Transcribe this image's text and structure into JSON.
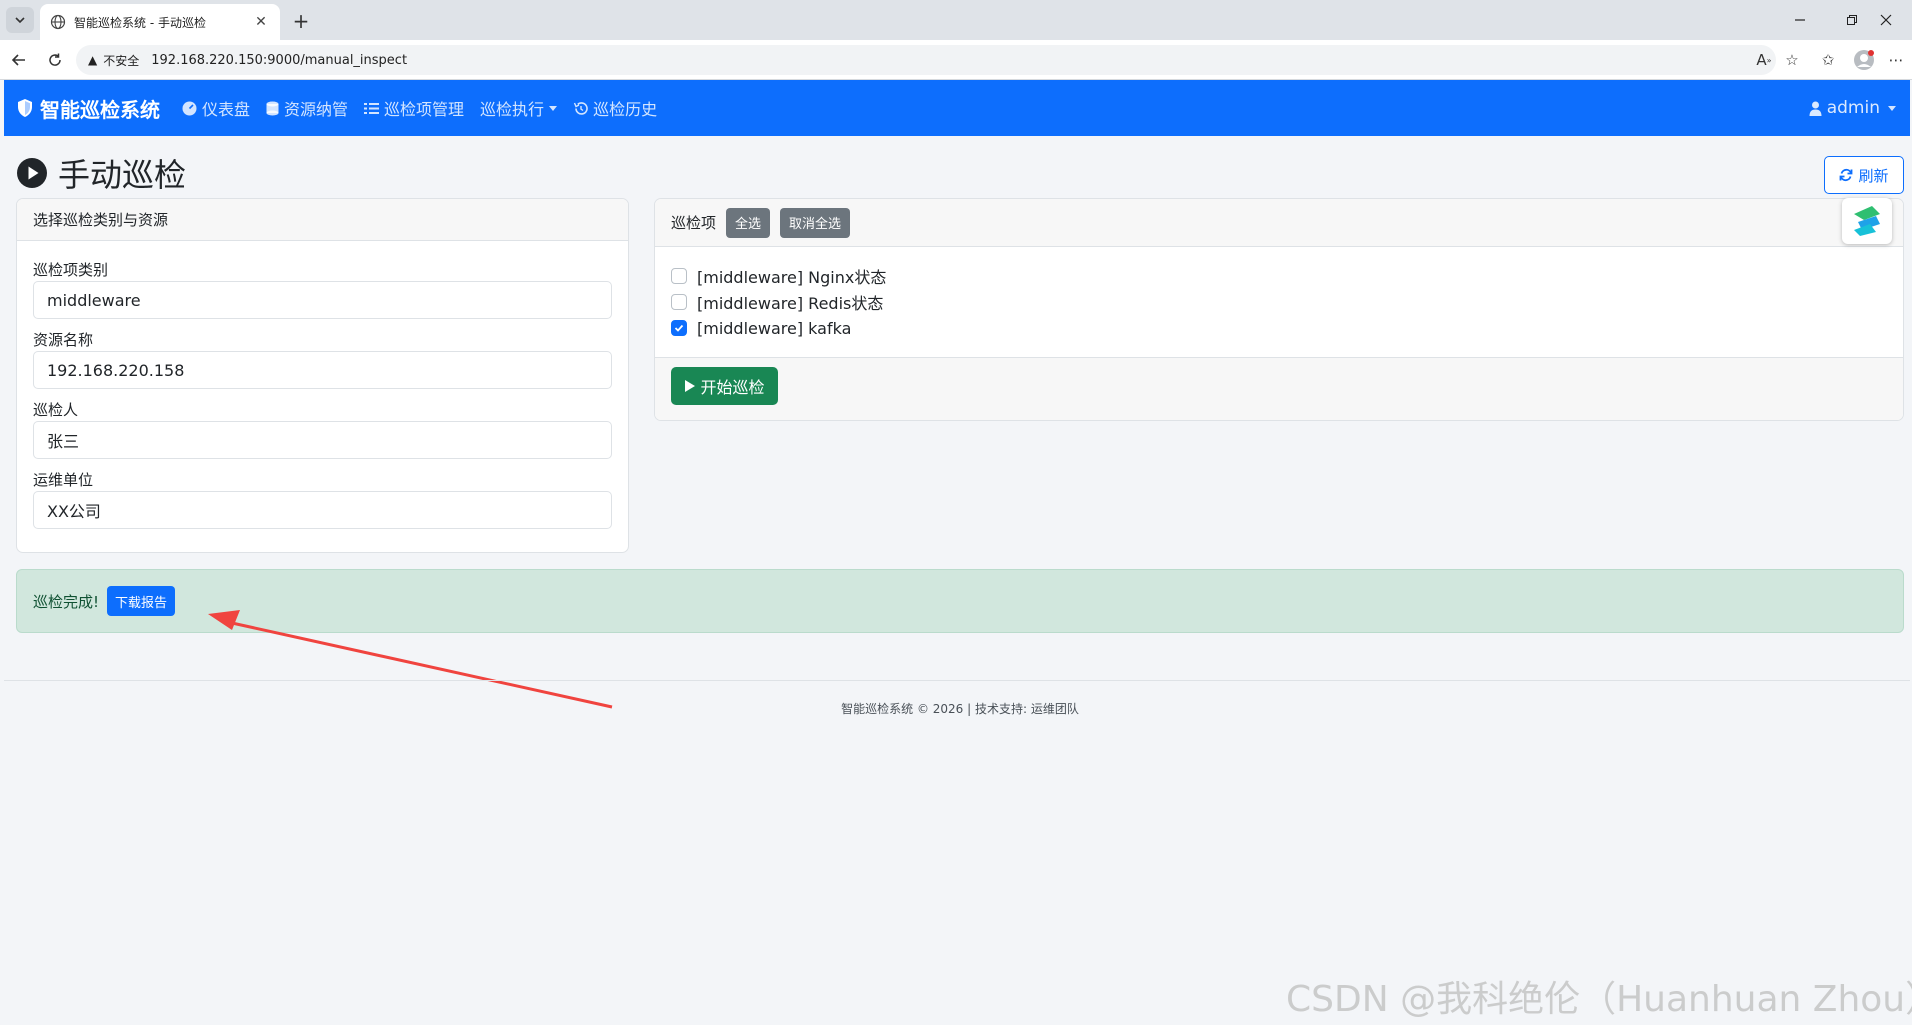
{
  "browser": {
    "tab_title": "智能巡检系统 - 手动巡检",
    "tab_close": "✕",
    "new_tab": "+",
    "insecure_label": "不安全",
    "url": "192.168.220.150:9000/manual_inspect"
  },
  "navbar": {
    "brand": "智能巡检系统",
    "items": [
      {
        "label": "仪表盘",
        "icon": "dashboard-icon"
      },
      {
        "label": "资源纳管",
        "icon": "database-icon"
      },
      {
        "label": "巡检项管理",
        "icon": "list-icon"
      },
      {
        "label": "巡检执行",
        "icon": "",
        "dropdown": true
      },
      {
        "label": "巡检历史",
        "icon": "history-icon"
      }
    ],
    "user": "admin",
    "color": "#0d6efd"
  },
  "page": {
    "title": "手动巡检",
    "refresh_label": "刷新"
  },
  "left_card": {
    "header": "选择巡检类别与资源",
    "fields": [
      {
        "label": "巡检项类别",
        "value": "middleware"
      },
      {
        "label": "资源名称",
        "value": "192.168.220.158"
      },
      {
        "label": "巡检人",
        "value": "张三"
      },
      {
        "label": "运维单位",
        "value": "XX公司"
      }
    ]
  },
  "right_card": {
    "header": "巡检项",
    "select_all": "全选",
    "deselect_all": "取消全选",
    "items": [
      {
        "label": "[middleware] Nginx状态",
        "checked": false
      },
      {
        "label": "[middleware] Redis状态",
        "checked": false
      },
      {
        "label": "[middleware] kafka",
        "checked": true
      }
    ],
    "start_label": "开始巡检"
  },
  "alert": {
    "message": "巡检完成!",
    "download_label": "下载报告",
    "color": "#d1e7dd"
  },
  "footer": {
    "text": "智能巡检系统 © 2026 | 技术支持: 运维团队"
  },
  "watermark": "CSDN @我科绝伦（Huanhuan Zhou）"
}
